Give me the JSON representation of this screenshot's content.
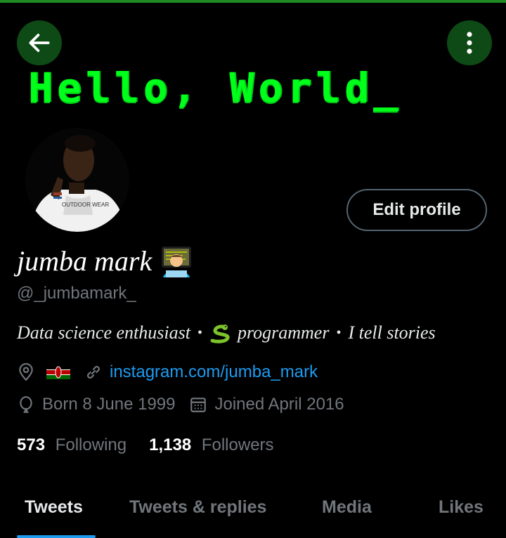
{
  "banner": {
    "text": "Hello, World_",
    "color": "#00ff1a"
  },
  "header": {
    "back_icon": "arrow-left-icon",
    "more_icon": "more-vertical-icon",
    "button_bg": "#0e4a15"
  },
  "profile": {
    "edit_label": "Edit profile",
    "display_name": "jumba mark",
    "name_emoji": "technologist-emoji",
    "handle": "@_jumbamark_",
    "bio": {
      "part1": "Data science enthusiast",
      "dot": "•",
      "snake_emoji": "snake-emoji",
      "part2": "programmer",
      "part3": "I tell stories"
    },
    "location_flag": "kenya-flag",
    "website": "instagram.com/jumba_mark",
    "birthday": "Born 8 June 1999",
    "joined": "Joined April 2016"
  },
  "stats": {
    "following_count": "573",
    "following_label": "Following",
    "followers_count": "1,138",
    "followers_label": "Followers"
  },
  "tabs": [
    {
      "label": "Tweets",
      "active": true
    },
    {
      "label": "Tweets & replies",
      "active": false
    },
    {
      "label": "Media",
      "active": false
    },
    {
      "label": "Likes",
      "active": false
    }
  ],
  "colors": {
    "accent": "#1d9bf0",
    "muted": "#71767b",
    "text": "#e7e9ea",
    "top_bar": "#1f8b24"
  }
}
